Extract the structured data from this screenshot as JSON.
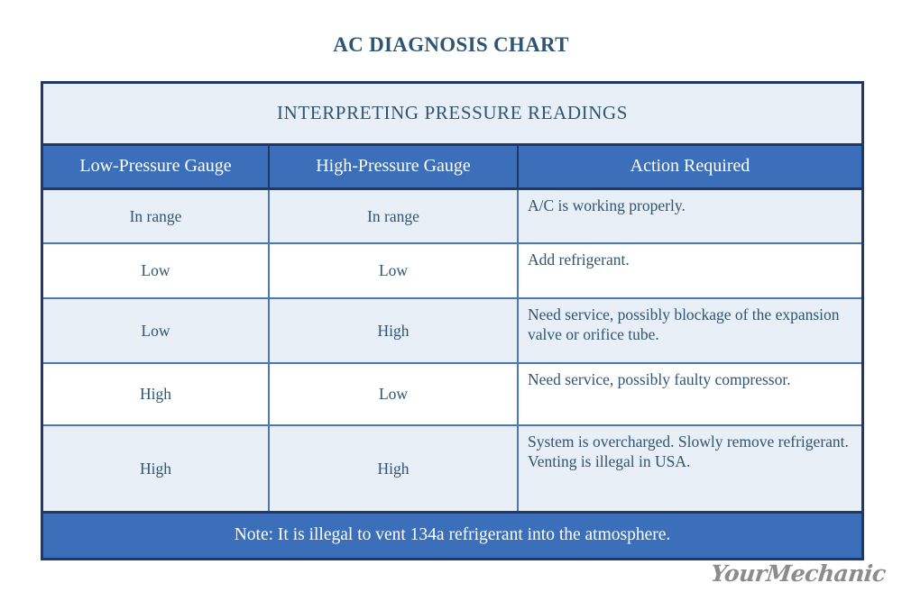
{
  "page": {
    "title": "AC DIAGNOSIS CHART",
    "background_color": "#FFFFFF"
  },
  "colors": {
    "border_dark": "#1F3864",
    "header_blue": "#3C6FB9",
    "row_tint": "#E8EFF7",
    "text_slate": "#2F5574",
    "text_white": "#FFFFFF",
    "logo_gray": "#8C8C8C",
    "grid_blue": "#4B77B8"
  },
  "table": {
    "banner": "INTERPRETING PRESSURE READINGS",
    "columns": [
      "Low-Pressure Gauge",
      "High-Pressure Gauge",
      "Action Required"
    ],
    "rows": [
      {
        "low": "In range",
        "high": "In range",
        "action": "A/C is working properly."
      },
      {
        "low": "Low",
        "high": "Low",
        "action": "Add refrigerant."
      },
      {
        "low": "Low",
        "high": "High",
        "action": "Need service, possibly blockage of the expansion valve or orifice tube."
      },
      {
        "low": "High",
        "high": "Low",
        "action": "Need service, possibly faulty compressor."
      },
      {
        "low": "High",
        "high": "High",
        "action": "System is overcharged. Slowly remove refrigerant. Venting is illegal in USA."
      }
    ],
    "note": "Note: It is illegal to vent 134a refrigerant into the atmosphere."
  },
  "logo": {
    "text": "YourMechanic"
  }
}
